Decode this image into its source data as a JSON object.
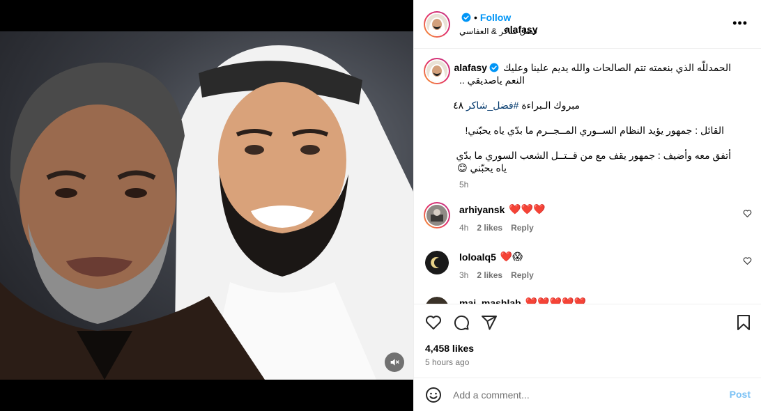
{
  "post": {
    "username": "alafasy",
    "follow_label": "Follow",
    "dot": "•",
    "collaborators": "فضل شاكر & العفاسي",
    "more_label": "•••"
  },
  "caption": {
    "username": "alafasy",
    "lines": [
      "الحمدللّه الذي بنعمته تتم الصالحات والله يديم علينا وعليك",
      "النعم ياصديقي .."
    ],
    "line3_prefix": "مبروك الـبراءة ",
    "hashtag": "#فضل_شاكر",
    "line3_suffix": " ٤٨",
    "line4": "القائل : جمهور يؤيد النظام الســوري المــجــرم ما بدّي ياه يحبّني!",
    "line5": "أتفق معه وأضيف : جمهور يقف مع من قــتــل الشعب السوري ما بدّي",
    "line6": "ياه يحبّني 😊",
    "time": "5h"
  },
  "comments": [
    {
      "username": "arhiyansk",
      "text": "❤️❤️❤️",
      "time": "4h",
      "likes": "2 likes",
      "reply": "Reply"
    },
    {
      "username": "loloalq5",
      "text": "❤️😱",
      "time": "3h",
      "likes": "2 likes",
      "reply": "Reply"
    },
    {
      "username": "mai_mashlab",
      "text": "❤️❤️❤️❤️❤️",
      "time": "",
      "likes": "",
      "reply": ""
    }
  ],
  "stats": {
    "likes": "4,458 likes",
    "time_ago": "5 hours ago"
  },
  "composer": {
    "placeholder": "Add a comment...",
    "post_label": "Post"
  },
  "colors": {
    "accent": "#0095f6",
    "verified": "#0095f6",
    "heart": "#e0245e",
    "muted": "#737373"
  }
}
